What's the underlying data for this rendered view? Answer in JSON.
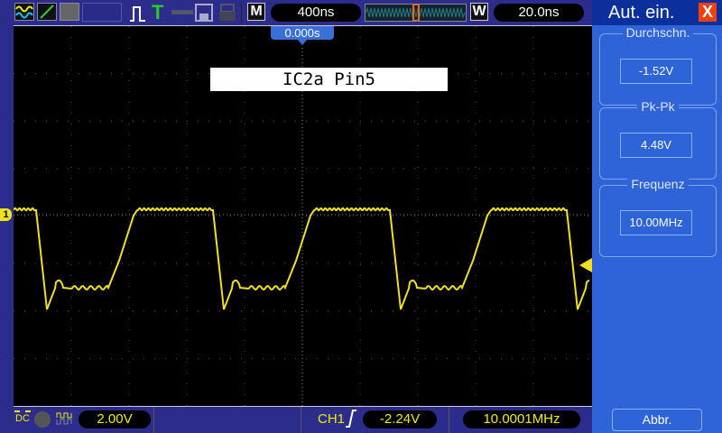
{
  "toolbar": {
    "timebase": "400ns",
    "window_timebase": "20.0ns",
    "m_label": "M",
    "w_label": "W",
    "trigger_icon_label": "T",
    "trigger_position": "0.000s"
  },
  "waveform": {
    "label": "IC2a Pin5",
    "channel_marker": "1",
    "color": "#f0e020"
  },
  "panel": {
    "title": "Aut. ein.",
    "close": "X",
    "measurements": [
      {
        "name": "Durchschn.",
        "value": "-1.52V"
      },
      {
        "name": "Pk-Pk",
        "value": "4.48V"
      },
      {
        "name": "Frequenz",
        "value": "10.00MHz"
      }
    ],
    "cancel": "Abbr."
  },
  "status": {
    "coupling": "DC",
    "volts_div": "2.00V",
    "trigger_source": "CH1",
    "trigger_level": "-2.24V",
    "frequency": "10.0001MHz"
  }
}
